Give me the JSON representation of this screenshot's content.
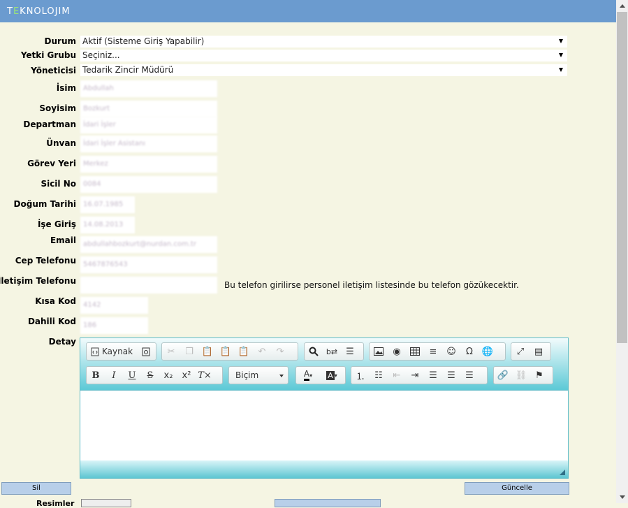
{
  "app": {
    "logo_prefix": "T",
    "logo_e": "E",
    "logo_rest": "KNOLOJIM"
  },
  "form": {
    "durum": {
      "label": "Durum",
      "value": "Aktif (Sisteme Giriş Yapabilir)"
    },
    "yetki": {
      "label": "Yetki Grubu",
      "value": "Seçiniz..."
    },
    "yonetici": {
      "label": "Yöneticisi",
      "value": "Tedarik Zincir Müdürü"
    },
    "isim": {
      "label": "İsim",
      "value": "Abdullah"
    },
    "soyisim": {
      "label": "Soyisim",
      "value": "Bozkurt"
    },
    "departman": {
      "label": "Departman",
      "value": "İdari İşler"
    },
    "unvan": {
      "label": "Ünvan",
      "value": "İdari İşler Asistanı"
    },
    "gorev": {
      "label": "Görev Yeri",
      "value": "Merkez"
    },
    "sicil": {
      "label": "Sicil No",
      "value": "0084"
    },
    "dogum": {
      "label": "Doğum Tarihi",
      "value": "16.07.1985"
    },
    "ise": {
      "label": "İşe Giriş",
      "value": "14.08.2013"
    },
    "email": {
      "label": "Email",
      "value": "abdullahbozkurt@nurdan.com.tr"
    },
    "cep": {
      "label": "Cep Telefonu",
      "value": "5467876543"
    },
    "iletisim": {
      "label": "İletişim Telefonu",
      "value": "",
      "note": "Bu telefon girilirse personel iletişim listesinde bu telefon gözükecektir."
    },
    "kisa": {
      "label": "Kısa Kod",
      "value": "4142"
    },
    "dahili": {
      "label": "Dahili Kod",
      "value": "186"
    },
    "detay": {
      "label": "Detay"
    }
  },
  "editor": {
    "source_label": "Kaynak",
    "format_label": "Biçim"
  },
  "actions": {
    "delete": "Sil",
    "update": "Güncelle",
    "images_label": "Resimler"
  }
}
